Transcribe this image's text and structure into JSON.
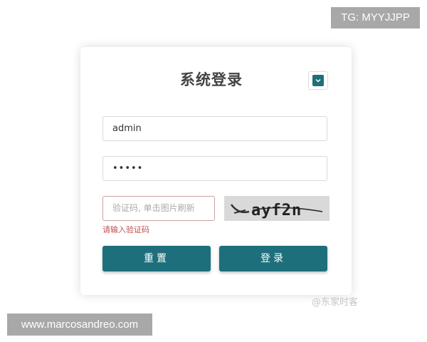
{
  "watermarks": {
    "telegram": "TG: MYYJJPP",
    "website": "www.marcosandreo.com",
    "author": "@东家时客"
  },
  "login": {
    "title": "系统登录",
    "username_value": "admin",
    "password_masked": "•••••",
    "captcha_placeholder": "验证码, 单击图片刷新",
    "captcha_error": "请输入验证码",
    "captcha_text": "ayf2n",
    "reset_label": "重置",
    "login_label": "登录"
  },
  "icons": {
    "language_toggle": "chevron-down-icon"
  },
  "colors": {
    "accent": "#1e6f7c",
    "error": "#c44d4d",
    "badge": "#a8a8a8"
  }
}
